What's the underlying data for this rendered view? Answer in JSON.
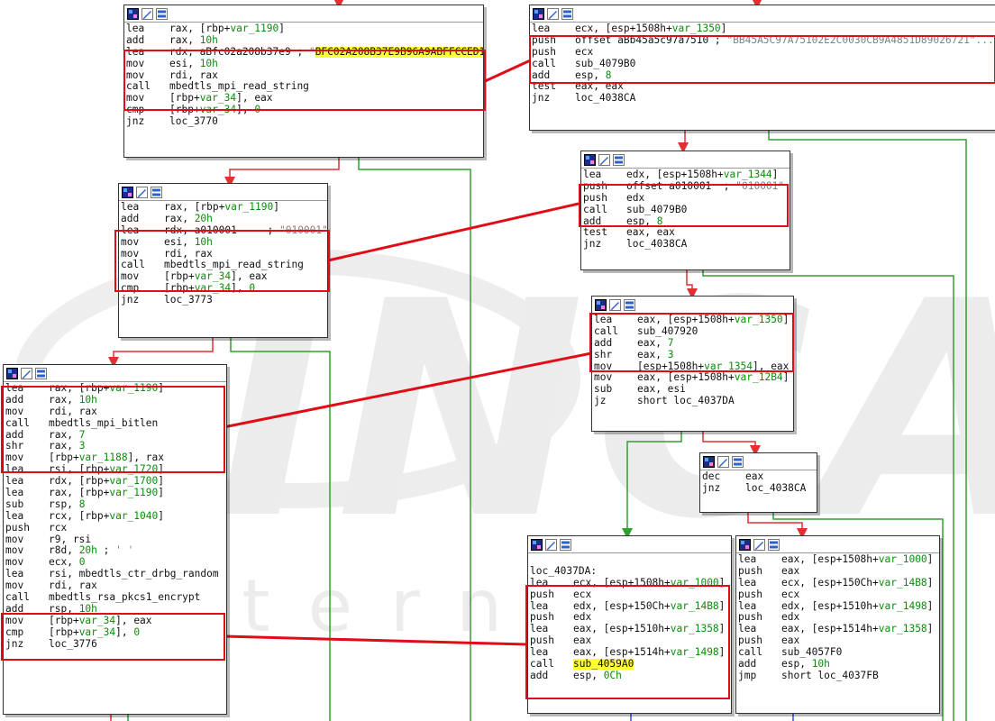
{
  "watermark": {
    "logo": "INCA",
    "text": "Internet"
  },
  "colors": {
    "true_edge": "#e03030",
    "false_edge": "#30a030",
    "highlight": "#ffff33",
    "box": "#e00d16",
    "number": "#0a8c0a",
    "comment": "#808080"
  },
  "blocks": [
    {
      "id": "b1",
      "rows": [
        {
          "mn": "lea",
          "op": [
            {
              "t": "rax, [rbp+"
            },
            {
              "t": "var_1190",
              "c": "gv"
            },
            {
              "t": "]"
            }
          ]
        },
        {
          "mn": "add",
          "op": [
            {
              "t": "rax, "
            },
            {
              "t": "10h",
              "c": "gv"
            }
          ]
        },
        {
          "mn": "lea",
          "op": [
            {
              "t": "rdx, aBfc02a208b37e9 ; "
            },
            {
              "t": "\"",
              "c": "cmt"
            },
            {
              "t": "BFC02A208B37E9B96A9ABFFCCED1",
              "c": "hl"
            }
          ]
        },
        {
          "mn": "mov",
          "op": [
            {
              "t": "esi, "
            },
            {
              "t": "10h",
              "c": "gv"
            }
          ]
        },
        {
          "mn": "mov",
          "op": [
            {
              "t": "rdi, rax"
            }
          ]
        },
        {
          "mn": "call",
          "op": [
            {
              "t": "mbedtls_mpi_read_string"
            }
          ]
        },
        {
          "mn": "mov",
          "op": [
            {
              "t": "[rbp+"
            },
            {
              "t": "var_34",
              "c": "gv"
            },
            {
              "t": "], eax"
            }
          ]
        },
        {
          "mn": "cmp",
          "op": [
            {
              "t": "[rbp+"
            },
            {
              "t": "var_34",
              "c": "gv"
            },
            {
              "t": "], "
            },
            {
              "t": "0",
              "c": "gv"
            }
          ]
        },
        {
          "mn": "jnz",
          "op": [
            {
              "t": "loc_3770"
            }
          ]
        }
      ]
    },
    {
      "id": "b2",
      "rows": [
        {
          "mn": "lea",
          "op": [
            {
              "t": "rax, [rbp+"
            },
            {
              "t": "var_1190",
              "c": "gv"
            },
            {
              "t": "]"
            }
          ]
        },
        {
          "mn": "add",
          "op": [
            {
              "t": "rax, "
            },
            {
              "t": "20h",
              "c": "gv"
            }
          ]
        },
        {
          "mn": "lea",
          "op": [
            {
              "t": "rdx, a010001     ; "
            },
            {
              "t": "\"010001\"",
              "c": "cmt"
            }
          ]
        },
        {
          "mn": "mov",
          "op": [
            {
              "t": "esi, "
            },
            {
              "t": "10h",
              "c": "gv"
            }
          ]
        },
        {
          "mn": "mov",
          "op": [
            {
              "t": "rdi, rax"
            }
          ]
        },
        {
          "mn": "call",
          "op": [
            {
              "t": "mbedtls_mpi_read_string"
            }
          ]
        },
        {
          "mn": "mov",
          "op": [
            {
              "t": "[rbp+"
            },
            {
              "t": "var_34",
              "c": "gv"
            },
            {
              "t": "], eax"
            }
          ]
        },
        {
          "mn": "cmp",
          "op": [
            {
              "t": "[rbp+"
            },
            {
              "t": "var_34",
              "c": "gv"
            },
            {
              "t": "], "
            },
            {
              "t": "0",
              "c": "gv"
            }
          ]
        },
        {
          "mn": "jnz",
          "op": [
            {
              "t": "loc_3773"
            }
          ]
        }
      ]
    },
    {
      "id": "b3",
      "rows": [
        {
          "mn": "lea",
          "op": [
            {
              "t": "rax, [rbp+"
            },
            {
              "t": "var_1190",
              "c": "gv"
            },
            {
              "t": "]"
            }
          ]
        },
        {
          "mn": "add",
          "op": [
            {
              "t": "rax, "
            },
            {
              "t": "10h",
              "c": "gv"
            }
          ]
        },
        {
          "mn": "mov",
          "op": [
            {
              "t": "rdi, rax"
            }
          ]
        },
        {
          "mn": "call",
          "op": [
            {
              "t": "mbedtls_mpi_bitlen"
            }
          ]
        },
        {
          "mn": "add",
          "op": [
            {
              "t": "rax, "
            },
            {
              "t": "7",
              "c": "gv"
            }
          ]
        },
        {
          "mn": "shr",
          "op": [
            {
              "t": "rax, "
            },
            {
              "t": "3",
              "c": "gv"
            }
          ]
        },
        {
          "mn": "mov",
          "op": [
            {
              "t": "[rbp+"
            },
            {
              "t": "var_1188",
              "c": "gv"
            },
            {
              "t": "], rax"
            }
          ]
        },
        {
          "mn": "lea",
          "op": [
            {
              "t": "rsi, [rbp+"
            },
            {
              "t": "var_1720",
              "c": "gv"
            },
            {
              "t": "]"
            }
          ]
        },
        {
          "mn": "lea",
          "op": [
            {
              "t": "rdx, [rbp+"
            },
            {
              "t": "var_1700",
              "c": "gv"
            },
            {
              "t": "]"
            }
          ]
        },
        {
          "mn": "lea",
          "op": [
            {
              "t": "rax, [rbp+"
            },
            {
              "t": "var_1190",
              "c": "gv"
            },
            {
              "t": "]"
            }
          ]
        },
        {
          "mn": "sub",
          "op": [
            {
              "t": "rsp, "
            },
            {
              "t": "8",
              "c": "gv"
            }
          ]
        },
        {
          "mn": "lea",
          "op": [
            {
              "t": "rcx, [rbp+"
            },
            {
              "t": "var_1040",
              "c": "gv"
            },
            {
              "t": "]"
            }
          ]
        },
        {
          "mn": "push",
          "op": [
            {
              "t": "rcx"
            }
          ]
        },
        {
          "mn": "mov",
          "op": [
            {
              "t": "r9, rsi"
            }
          ]
        },
        {
          "mn": "mov",
          "op": [
            {
              "t": "r8d, "
            },
            {
              "t": "20h",
              "c": "gv"
            },
            {
              "t": " ; "
            },
            {
              "t": "' '",
              "c": "cmt"
            }
          ]
        },
        {
          "mn": "mov",
          "op": [
            {
              "t": "ecx, "
            },
            {
              "t": "0",
              "c": "gv"
            }
          ]
        },
        {
          "mn": "lea",
          "op": [
            {
              "t": "rsi, mbedtls_ctr_drbg_random"
            }
          ]
        },
        {
          "mn": "mov",
          "op": [
            {
              "t": "rdi, rax"
            }
          ]
        },
        {
          "mn": "call",
          "op": [
            {
              "t": "mbedtls_rsa_pkcs1_encrypt"
            }
          ]
        },
        {
          "mn": "add",
          "op": [
            {
              "t": "rsp, "
            },
            {
              "t": "10h",
              "c": "gv"
            }
          ]
        },
        {
          "mn": "mov",
          "op": [
            {
              "t": "[rbp+"
            },
            {
              "t": "var_34",
              "c": "gv"
            },
            {
              "t": "], eax"
            }
          ]
        },
        {
          "mn": "cmp",
          "op": [
            {
              "t": "[rbp+"
            },
            {
              "t": "var_34",
              "c": "gv"
            },
            {
              "t": "], "
            },
            {
              "t": "0",
              "c": "gv"
            }
          ]
        },
        {
          "mn": "jnz",
          "op": [
            {
              "t": "loc_3776"
            }
          ]
        }
      ]
    },
    {
      "id": "b4",
      "rows": [
        {
          "mn": "lea",
          "op": [
            {
              "t": "ecx, [esp+1508h+"
            },
            {
              "t": "var_1350",
              "c": "gv"
            },
            {
              "t": "]"
            }
          ]
        },
        {
          "mn": "push",
          "op": [
            {
              "t": "offset aBb45a5c97a7510 ; "
            },
            {
              "t": "\"BB45A5C97A75102E2C0030CB9A4851D89026721\"...",
              "c": "cmt"
            }
          ]
        },
        {
          "mn": "push",
          "op": [
            {
              "t": "ecx"
            }
          ]
        },
        {
          "mn": "call",
          "op": [
            {
              "t": "sub_4079B0"
            }
          ]
        },
        {
          "mn": "add",
          "op": [
            {
              "t": "esp, "
            },
            {
              "t": "8",
              "c": "gv"
            }
          ]
        },
        {
          "mn": "test",
          "op": [
            {
              "t": "eax, eax"
            }
          ]
        },
        {
          "mn": "jnz",
          "op": [
            {
              "t": "loc_4038CA"
            }
          ]
        }
      ]
    },
    {
      "id": "b5",
      "rows": [
        {
          "mn": "lea",
          "op": [
            {
              "t": "edx, [esp+1508h+"
            },
            {
              "t": "var_1344",
              "c": "gv"
            },
            {
              "t": "]"
            }
          ]
        },
        {
          "mn": "push",
          "op": [
            {
              "t": "offset a010001  ; "
            },
            {
              "t": "\"010001\"",
              "c": "cmt"
            }
          ]
        },
        {
          "mn": "push",
          "op": [
            {
              "t": "edx"
            }
          ]
        },
        {
          "mn": "call",
          "op": [
            {
              "t": "sub_4079B0"
            }
          ]
        },
        {
          "mn": "add",
          "op": [
            {
              "t": "esp, "
            },
            {
              "t": "8",
              "c": "gv"
            }
          ]
        },
        {
          "mn": "test",
          "op": [
            {
              "t": "eax, eax"
            }
          ]
        },
        {
          "mn": "jnz",
          "op": [
            {
              "t": "loc_4038CA"
            }
          ]
        }
      ]
    },
    {
      "id": "b6",
      "rows": [
        {
          "mn": "lea",
          "op": [
            {
              "t": "eax, [esp+1508h+"
            },
            {
              "t": "var_1350",
              "c": "gv"
            },
            {
              "t": "]"
            }
          ]
        },
        {
          "mn": "call",
          "op": [
            {
              "t": "sub_407920"
            }
          ]
        },
        {
          "mn": "add",
          "op": [
            {
              "t": "eax, "
            },
            {
              "t": "7",
              "c": "gv"
            }
          ]
        },
        {
          "mn": "shr",
          "op": [
            {
              "t": "eax, "
            },
            {
              "t": "3",
              "c": "gv"
            }
          ]
        },
        {
          "mn": "mov",
          "op": [
            {
              "t": "[esp+1508h+"
            },
            {
              "t": "var_1354",
              "c": "gv"
            },
            {
              "t": "], eax"
            }
          ]
        },
        {
          "mn": "mov",
          "op": [
            {
              "t": "eax, [esp+1508h+"
            },
            {
              "t": "var_12B4",
              "c": "gv"
            },
            {
              "t": "]"
            }
          ]
        },
        {
          "mn": "sub",
          "op": [
            {
              "t": "eax, esi"
            }
          ]
        },
        {
          "mn": "jz",
          "op": [
            {
              "t": "short loc_4037DA"
            }
          ]
        }
      ]
    },
    {
      "id": "b7",
      "rows": [
        {
          "mn": "dec",
          "op": [
            {
              "t": "eax"
            }
          ]
        },
        {
          "mn": "jnz",
          "op": [
            {
              "t": "loc_4038CA"
            }
          ]
        }
      ]
    },
    {
      "id": "b8",
      "rows": [
        {
          "label": ""
        },
        {
          "label": "loc_4037DA:"
        },
        {
          "mn": "lea",
          "op": [
            {
              "t": "ecx, [esp+1508h+"
            },
            {
              "t": "var_1000",
              "c": "gv"
            },
            {
              "t": "]"
            }
          ]
        },
        {
          "mn": "push",
          "op": [
            {
              "t": "ecx"
            }
          ]
        },
        {
          "mn": "lea",
          "op": [
            {
              "t": "edx, [esp+150Ch+"
            },
            {
              "t": "var_14B8",
              "c": "gv"
            },
            {
              "t": "]"
            }
          ]
        },
        {
          "mn": "push",
          "op": [
            {
              "t": "edx"
            }
          ]
        },
        {
          "mn": "lea",
          "op": [
            {
              "t": "eax, [esp+1510h+"
            },
            {
              "t": "var_1358",
              "c": "gv"
            },
            {
              "t": "]"
            }
          ]
        },
        {
          "mn": "push",
          "op": [
            {
              "t": "eax"
            }
          ]
        },
        {
          "mn": "lea",
          "op": [
            {
              "t": "eax, [esp+1514h+"
            },
            {
              "t": "var_1498",
              "c": "gv"
            },
            {
              "t": "]"
            }
          ]
        },
        {
          "mn": "call",
          "op": [
            {
              "t": "sub_4059A0",
              "c": "hl"
            }
          ]
        },
        {
          "mn": "add",
          "op": [
            {
              "t": "esp, "
            },
            {
              "t": "0Ch",
              "c": "gv"
            }
          ]
        }
      ]
    },
    {
      "id": "b9",
      "rows": [
        {
          "mn": "lea",
          "op": [
            {
              "t": "eax, [esp+1508h+"
            },
            {
              "t": "var_1000",
              "c": "gv"
            },
            {
              "t": "]"
            }
          ]
        },
        {
          "mn": "push",
          "op": [
            {
              "t": "eax"
            }
          ]
        },
        {
          "mn": "lea",
          "op": [
            {
              "t": "ecx, [esp+150Ch+"
            },
            {
              "t": "var_14B8",
              "c": "gv"
            },
            {
              "t": "]"
            }
          ]
        },
        {
          "mn": "push",
          "op": [
            {
              "t": "ecx"
            }
          ]
        },
        {
          "mn": "lea",
          "op": [
            {
              "t": "edx, [esp+1510h+"
            },
            {
              "t": "var_1498",
              "c": "gv"
            },
            {
              "t": "]"
            }
          ]
        },
        {
          "mn": "push",
          "op": [
            {
              "t": "edx"
            }
          ]
        },
        {
          "mn": "lea",
          "op": [
            {
              "t": "eax, [esp+1514h+"
            },
            {
              "t": "var_1358",
              "c": "gv"
            },
            {
              "t": "]"
            }
          ]
        },
        {
          "mn": "push",
          "op": [
            {
              "t": "eax"
            }
          ]
        },
        {
          "mn": "call",
          "op": [
            {
              "t": "sub_4057F0"
            }
          ]
        },
        {
          "mn": "add",
          "op": [
            {
              "t": "esp, "
            },
            {
              "t": "10h",
              "c": "gv"
            }
          ]
        },
        {
          "mn": "jmp",
          "op": [
            {
              "t": "short loc_4037FB"
            }
          ]
        }
      ]
    }
  ]
}
